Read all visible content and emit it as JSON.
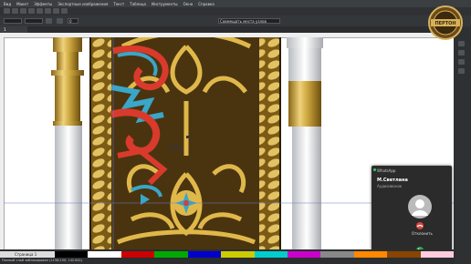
{
  "app": {
    "menu": [
      "Вид",
      "Макет",
      "Эффекты",
      "Экспортные изображения",
      "Текст",
      "Таблица",
      "Инструменты",
      "Окно",
      "Справка"
    ],
    "search_placeholder": "Совмещать места узлов",
    "zoom": "0",
    "doc_tab": "1"
  },
  "canvas": {
    "page_label": "Страница 1",
    "status": "Полный слой заблокирован (1158;150; 142.841)"
  },
  "notification": {
    "app_name": "WhatsApp",
    "caller": "М.Светлана",
    "call_type": "Аудиозвонок",
    "decline_label": "Отклонить",
    "accept_label": "Принять"
  },
  "logo_text": "ПЕРТОН",
  "colors": {
    "gold": "#c8a23a",
    "red": "#d93a2c",
    "blue": "#3aa6c9",
    "decline": "#d9463e",
    "accept": "#2ea84f"
  }
}
